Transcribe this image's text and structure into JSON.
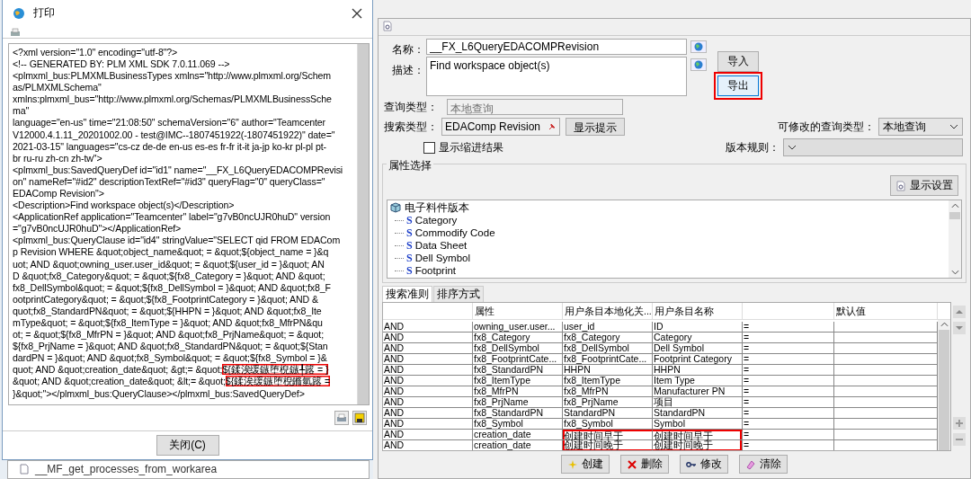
{
  "print_dialog": {
    "title": "打印",
    "xml_lines": [
      {
        "text": "<?xml version=\"1.0\" encoding=\"utf-8\"?>"
      },
      {
        "text": "<!-- GENERATED BY: PLM XML SDK 7.0.11.069 -->"
      },
      {
        "text": "<plmxml_bus:PLMXMLBusinessTypes xmlns=\"http://www.plmxml.org/Schem"
      },
      {
        "text": "as/PLMXMLSchema\""
      },
      {
        "text": " xmlns:plmxml_bus=\"http://www.plmxml.org/Schemas/PLMXMLBusinessSche"
      },
      {
        "text": "ma\""
      },
      {
        "text": " language=\"en-us\" time=\"21:08:50\" schemaVersion=\"6\" author=\"Teamcenter"
      },
      {
        "text": " V12000.4.1.11_20201002.00 - test@IMC--1807451922(-1807451922)\" date=\""
      },
      {
        "text": "2021-03-15\" languages=\"cs-cz de-de en-us es-es fr-fr it-it ja-jp ko-kr pl-pl pt-"
      },
      {
        "text": "br ru-ru zh-cn zh-tw\">"
      },
      {
        "text": "<plmxml_bus:SavedQueryDef id=\"id1\" name=\"__FX_L6QueryEDACOMPRevisi"
      },
      {
        "text": "on\" nameRef=\"#id2\" descriptionTextRef=\"#id3\" queryFlag=\"0\" queryClass=\""
      },
      {
        "text": "EDAComp Revision\">"
      },
      {
        "text": "<Description>Find workspace object(s)</Description>"
      },
      {
        "text": "<ApplicationRef application=\"Teamcenter\" label=\"g7vB0ncUJR0huD\" version"
      },
      {
        "text": "=\"g7vB0ncUJR0huD\"></ApplicationRef>"
      },
      {
        "text": "<plmxml_bus:QueryClause id=\"id4\" stringValue=\"SELECT qid FROM EDACom"
      },
      {
        "text": "p Revision WHERE &quot;object_name&quot; = &quot;${object_name = }&q"
      },
      {
        "text": "uot; AND &quot;owning_user.user_id&quot; = &quot;${user_id = }&quot; AN"
      },
      {
        "text": "D &quot;fx8_Category&quot; = &quot;${fx8_Category = }&quot; AND &quot;"
      },
      {
        "text": "fx8_DellSymbol&quot; = &quot;${fx8_DellSymbol = }&quot; AND &quot;fx8_F"
      },
      {
        "text": "ootprintCategory&quot; = &quot;${fx8_FootprintCategory = }&quot; AND &"
      },
      {
        "text": "quot;fx8_StandardPN&quot; = &quot;${HHPN = }&quot; AND &quot;fx8_Ite"
      },
      {
        "text": "mType&quot; = &quot;${fx8_ItemType = }&quot; AND &quot;fx8_MfrPN&qu"
      },
      {
        "text": "ot; = &quot;${fx8_MfrPN = }&quot; AND &quot;fx8_PrjName&quot; = &quot;"
      },
      {
        "text": "${fx8_PrjName = }&quot; AND &quot;fx8_StandardPN&quot; = &quot;${Stan"
      },
      {
        "text": "dardPN = }&quot; AND &quot;fx8_Symbol&quot; = &quot;${fx8_Symbol = }&"
      },
      {
        "text": "quot; AND &quot;creation_date&quot; &gt;= &quot;",
        "boxed": "${鍒涘缓鏃堕棿鏃╀簬 = }"
      },
      {
        "text": "&quot; AND &quot;creation_date&quot; &lt;= &quot;",
        "boxed": "${鍒涘缓鏃堕棿鏅氫簬 ="
      },
      {
        "text": "}&quot;\"></plmxml_bus:QueryClause></plmxml_bus:SavedQueryDef>"
      }
    ],
    "close_button": "关闭(C)"
  },
  "background_tree": {
    "items": [
      "__MF_get_processes_from_workarea"
    ]
  },
  "query_panel": {
    "name_label": "名称：",
    "name": "__FX_L6QueryEDACOMPRevision",
    "description_label": "描述：",
    "description": "Find workspace object(s)",
    "import_button": {
      "label": "导入",
      "highlighted": false
    },
    "export_button": {
      "label": "导出",
      "highlighted": true
    },
    "query_type_label": "查询类型：",
    "query_type": "本地查询",
    "search_type_label": "搜索类型：",
    "search_type": "EDAComp Revision",
    "hint_button": "显示提示",
    "modifiable_label": "可修改的查询类型：",
    "modifiable_value": "本地查询",
    "indent_checkbox": {
      "label": "显示缩进结果",
      "checked": false
    },
    "revision_rule_label": "版本规则："
  },
  "attribute_group": {
    "title": "属性选择",
    "settings_button": "显示设置",
    "tree": {
      "label": "电子料件版本",
      "children": [
        {
          "glyph": "S",
          "label": "Category"
        },
        {
          "glyph": "S",
          "label": "Commodify Code"
        },
        {
          "glyph": "S",
          "label": "Data Sheet"
        },
        {
          "glyph": "S",
          "label": "Dell Symbol"
        },
        {
          "glyph": "S",
          "label": "Footprint"
        }
      ]
    }
  },
  "tabs": [
    {
      "label": "搜索准则",
      "selected": true
    },
    {
      "label": "排序方式",
      "selected": false
    }
  ],
  "table": {
    "columns": [
      {
        "kind": "blank"
      },
      {
        "kind": "title",
        "label": "属性"
      },
      {
        "kind": "title",
        "label": "用户条目本地化关..."
      },
      {
        "kind": "title",
        "label": "用户条目名称"
      },
      {
        "kind": "blank"
      },
      {
        "kind": "title",
        "label": "默认值"
      }
    ],
    "rows": [
      {
        "cells": [
          "AND",
          "owning_user.user...",
          "user_id",
          "ID",
          "="
        ],
        "highlighted": false
      },
      {
        "cells": [
          "AND",
          "fx8_Category",
          "fx8_Category",
          "Category",
          "="
        ],
        "highlighted": false
      },
      {
        "cells": [
          "AND",
          "fx8_DellSymbol",
          "fx8_DellSymbol",
          "Dell Symbol",
          "="
        ],
        "highlighted": false
      },
      {
        "cells": [
          "AND",
          "fx8_FootprintCate...",
          "fx8_FootprintCate...",
          "Footprint Category",
          "="
        ],
        "highlighted": false
      },
      {
        "cells": [
          "AND",
          "fx8_StandardPN",
          "HHPN",
          "HHPN",
          "="
        ],
        "highlighted": false
      },
      {
        "cells": [
          "AND",
          "fx8_ItemType",
          "fx8_ItemType",
          "Item Type",
          "="
        ],
        "highlighted": false
      },
      {
        "cells": [
          "AND",
          "fx8_MfrPN",
          "fx8_MfrPN",
          "Manufacturer PN",
          "="
        ],
        "highlighted": false
      },
      {
        "cells": [
          "AND",
          "fx8_PrjName",
          "fx8_PrjName",
          "项目",
          "="
        ],
        "highlighted": false
      },
      {
        "cells": [
          "AND",
          "fx8_StandardPN",
          "StandardPN",
          "StandardPN",
          "="
        ],
        "highlighted": false
      },
      {
        "cells": [
          "AND",
          "fx8_Symbol",
          "fx8_Symbol",
          "Symbol",
          "="
        ],
        "highlighted": false
      },
      {
        "cells": [
          "AND",
          "creation_date",
          "创建时间早于",
          "创建时间早于",
          "="
        ],
        "highlighted": true
      },
      {
        "cells": [
          "AND",
          "creation_date",
          "创建时间晚于",
          "创建时间晚于",
          "="
        ],
        "highlighted": true
      }
    ]
  },
  "actions": [
    {
      "kind": "create",
      "label": "创建"
    },
    {
      "kind": "delete",
      "label": "删除"
    },
    {
      "kind": "modify",
      "label": "修改"
    },
    {
      "kind": "clear",
      "label": "清除"
    }
  ]
}
